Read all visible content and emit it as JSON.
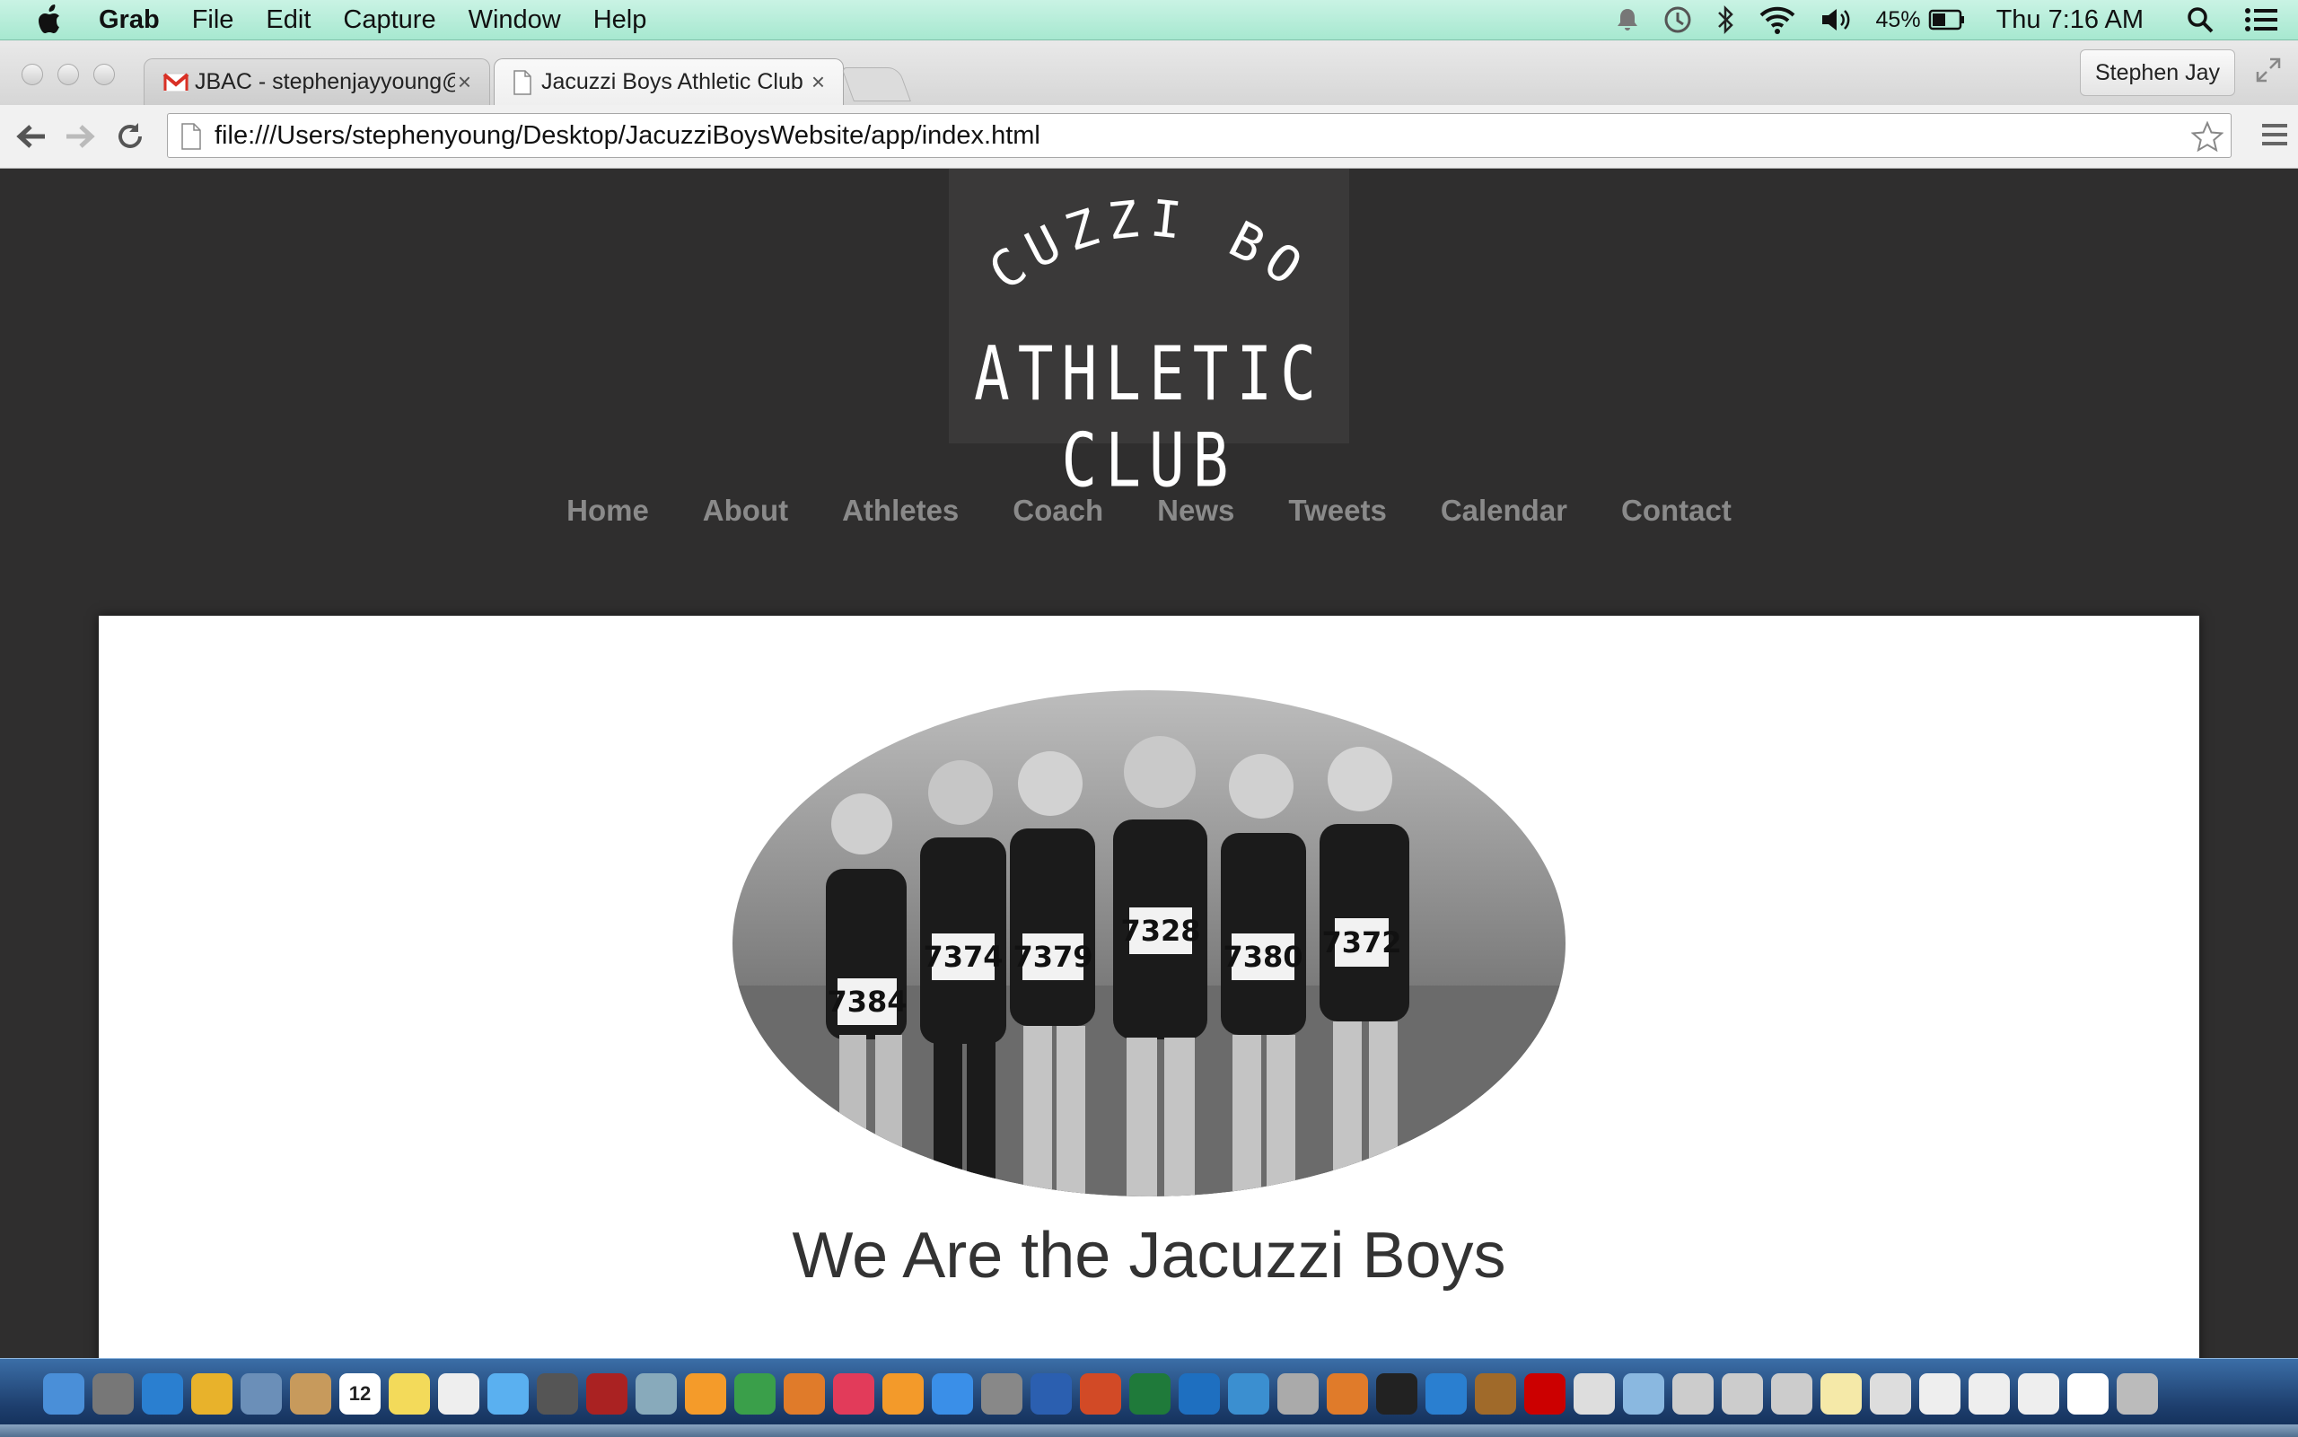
{
  "menubar": {
    "app_name": "Grab",
    "menus": [
      "File",
      "Edit",
      "Capture",
      "Window",
      "Help"
    ],
    "battery_percent": "45%",
    "clock": "Thu 7:16 AM"
  },
  "browser": {
    "tabs": [
      {
        "label": "JBAC - stephenjayyoung@g",
        "icon": "gmail-icon"
      },
      {
        "label": "Jacuzzi Boys Athletic Club",
        "icon": "page-icon"
      }
    ],
    "profile_name": "Stephen Jay",
    "url": "file:///Users/stephenyoung/Desktop/JacuzziBoysWebsite/app/index.html"
  },
  "site": {
    "logo_line1": "JACUZZI BOYS",
    "logo_line2": "ATHLETIC CLUB",
    "nav": [
      "Home",
      "About",
      "Athletes",
      "Coach",
      "News",
      "Tweets",
      "Calendar",
      "Contact"
    ],
    "photo_bibs": [
      "7384",
      "7374",
      "7379",
      "7328",
      "7380",
      "7372"
    ],
    "headline": "We Are the Jacuzzi Boys"
  },
  "dock": {
    "calendar_day": "12",
    "icons": [
      "finder-icon",
      "launchpad-icon",
      "safari-icon",
      "chrome-icon",
      "preview-icon",
      "contacts-icon",
      "calendar-icon",
      "notes-icon",
      "reminders-icon",
      "messages-icon",
      "facetime-icon",
      "photo-booth-icon",
      "iphoto-icon",
      "pages-icon",
      "numbers-icon",
      "keynote-icon",
      "itunes-icon",
      "ibooks-icon",
      "app-store-icon",
      "system-preferences-icon",
      "word-icon",
      "powerpoint-icon",
      "excel-icon",
      "outlook-icon",
      "network-icon",
      "utility-icon",
      "sublime-icon",
      "terminal-icon",
      "qr-icon",
      "acorn-icon",
      "acrobat-icon",
      "archive-icon",
      "folder-icon",
      "png-file-icon",
      "png-file-icon-2",
      "png-file-icon-3",
      "note-file-icon",
      "screenshot-icon",
      "window-thumb-icon",
      "window-thumb-icon-2",
      "window-thumb-icon-3",
      "document-icon",
      "trash-icon"
    ]
  }
}
